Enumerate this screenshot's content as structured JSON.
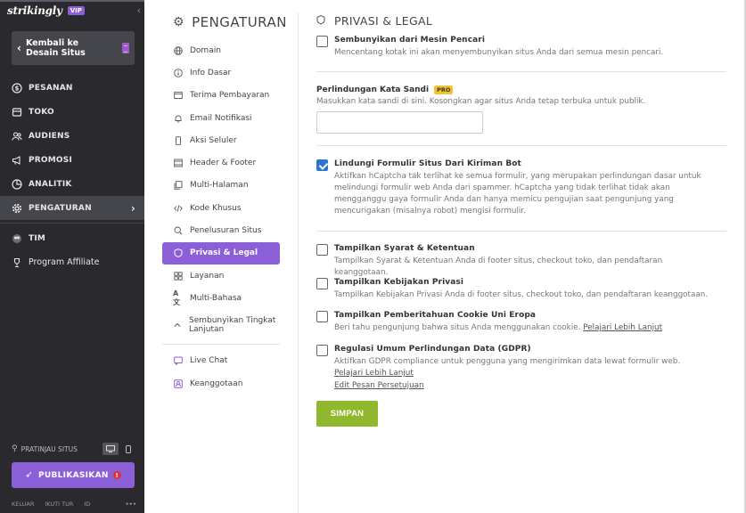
{
  "sidebar": {
    "logo": "strikingly",
    "vip": "VIP",
    "back_label": "Kembali ke Desain Situs",
    "items": [
      {
        "label": "PESANAN",
        "icon": "dollar-icon"
      },
      {
        "label": "TOKO",
        "icon": "store-icon"
      },
      {
        "label": "AUDIENS",
        "icon": "users-icon"
      },
      {
        "label": "PROMOSI",
        "icon": "megaphone-icon"
      },
      {
        "label": "ANALITIK",
        "icon": "chart-icon"
      },
      {
        "label": "PENGATURAN",
        "icon": "gear-icon"
      }
    ],
    "extra_items": [
      {
        "label": "TIM",
        "icon": "team-icon"
      },
      {
        "label": "Program Affiliate",
        "icon": "trophy-icon"
      }
    ],
    "preview_label": "PRATINJAU SITUS",
    "publish_label": "PUBLIKASIKAN",
    "publish_alert": "!",
    "footer": [
      "KELUAR",
      "IKUTI TUR",
      "ID",
      "•••"
    ]
  },
  "submenu": {
    "title": "PENGATURAN",
    "items": [
      {
        "label": "Domain",
        "icon": "globe-icon"
      },
      {
        "label": "Info Dasar",
        "icon": "info-icon"
      },
      {
        "label": "Terima Pembayaran",
        "icon": "payment-icon"
      },
      {
        "label": "Email Notifikasi",
        "icon": "bell-icon"
      },
      {
        "label": "Aksi Seluler",
        "icon": "mobile-icon"
      },
      {
        "label": "Header & Footer",
        "icon": "layout-icon"
      },
      {
        "label": "Multi-Halaman",
        "icon": "pages-icon"
      },
      {
        "label": "Kode Khusus",
        "icon": "code-icon"
      },
      {
        "label": "Penelusuran Situs",
        "icon": "search-icon"
      },
      {
        "label": "Privasi & Legal",
        "icon": "shield-icon"
      },
      {
        "label": "Layanan",
        "icon": "grid-icon"
      },
      {
        "label": "Multi-Bahasa",
        "icon": "translate-icon"
      },
      {
        "label": "Sembunyikan Tingkat Lanjutan",
        "icon": "chevron-up-icon"
      }
    ],
    "bottom_items": [
      {
        "label": "Live Chat",
        "icon": "chat-icon"
      },
      {
        "label": "Keanggotaan",
        "icon": "member-icon"
      }
    ]
  },
  "content": {
    "title": "PRIVASI & LEGAL",
    "hide_search": {
      "label": "Sembunyikan dari Mesin Pencari",
      "desc": "Mencentang kotak ini akan menyembunyikan situs Anda dari semua mesin pencari.",
      "checked": false
    },
    "password": {
      "label": "Perlindungan Kata Sandi",
      "badge": "PRO",
      "desc": "Masukkan kata sandi di sini. Kosongkan agar situs Anda tetap terbuka untuk publik.",
      "value": ""
    },
    "bot": {
      "label": "Lindungi Formulir Situs Dari Kiriman Bot",
      "desc": "Aktifkan hCaptcha tak terlihat ke semua formulir, yang merupakan perlindungan dasar untuk melindungi formulir web Anda dari spammer. hCaptcha yang tidak terlihat tidak akan mengganggu gaya formulir Anda dan hanya memicu pengujian saat pengunjung yang mencurigakan (misalnya robot) mengisi formulir.",
      "checked": true
    },
    "terms": {
      "label": "Tampilkan Syarat & Ketentuan",
      "desc": "Tampilkan Syarat & Ketentuan Anda di footer situs, checkout toko, dan pendaftaran keanggotaan.",
      "checked": false
    },
    "privacy": {
      "label": "Tampilkan Kebijakan Privasi",
      "desc": "Tampilkan Kebijakan Privasi Anda di footer situs, checkout toko, dan pendaftaran keanggotaan.",
      "checked": false
    },
    "cookie": {
      "label": "Tampilkan Pemberitahuan Cookie Uni Eropa",
      "desc": "Beri tahu pengunjung bahwa situs Anda menggunakan cookie.",
      "link": "Pelajari Lebih Lanjut",
      "checked": false
    },
    "gdpr": {
      "label": "Regulasi Umum Perlindungan Data (GDPR)",
      "desc": "Aktifkan GDPR compliance untuk pengguna yang mengirimkan data lewat formulir web.",
      "link": "Pelajari Lebih Lanjut",
      "edit_link": "Edit Pesan Persetujuan",
      "checked": false
    },
    "save_label": "SIMPAN"
  },
  "colors": {
    "sidebar_bg": "#2a2a2e",
    "accent": "#8b5fd8",
    "save": "#8fb82c",
    "checkbox": "#2a76d2",
    "pro_badge": "#f2c230"
  }
}
